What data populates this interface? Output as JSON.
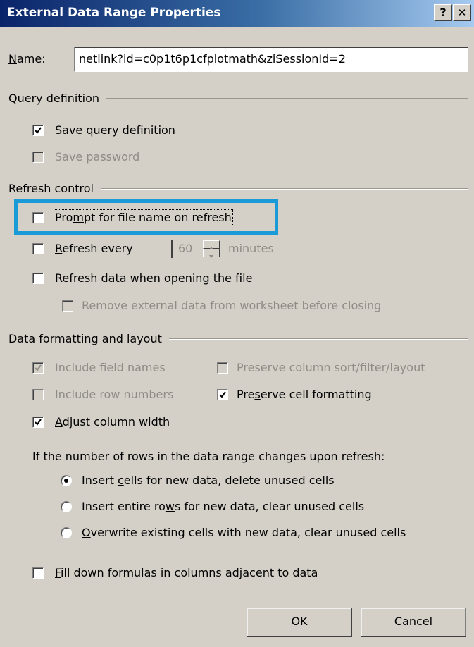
{
  "window": {
    "title": "External Data Range Properties",
    "help_label": "?",
    "close_label": "✕"
  },
  "name_field": {
    "label": "Name:",
    "value": "netlink?id=c0p1t6p1cfplotmath&ziSessionId=2"
  },
  "query_definition": {
    "heading": "Query definition",
    "save_query": {
      "label": "Save query definition",
      "checked": true,
      "enabled": true
    },
    "save_password": {
      "label": "Save password",
      "checked": false,
      "enabled": false
    }
  },
  "refresh_control": {
    "heading": "Refresh control",
    "prompt_file": {
      "label": "Prompt for file name on refresh",
      "checked": false,
      "enabled": true,
      "highlighted": true
    },
    "refresh_every": {
      "label": "Refresh every",
      "checked": false,
      "value": "60",
      "unit": "minutes"
    },
    "refresh_on_open": {
      "label": "Refresh data when opening the file",
      "checked": false
    },
    "remove_external": {
      "label": "Remove external data from worksheet before closing",
      "checked": false,
      "enabled": false
    }
  },
  "data_formatting": {
    "heading": "Data formatting and layout",
    "include_field_names": {
      "label": "Include field names",
      "checked": true,
      "enabled": false
    },
    "preserve_sort": {
      "label": "Preserve column sort/filter/layout",
      "checked": false,
      "enabled": false
    },
    "include_row_numbers": {
      "label": "Include row numbers",
      "checked": false,
      "enabled": false
    },
    "preserve_cell_formatting": {
      "label": "Preserve cell formatting",
      "checked": true,
      "enabled": true
    },
    "adjust_column_width": {
      "label": "Adjust column width",
      "checked": true,
      "enabled": true
    },
    "rows_change_prompt": "If the number of rows in the data range changes upon refresh:",
    "options": [
      {
        "label": "Insert cells for new data, delete unused cells",
        "selected": true
      },
      {
        "label": "Insert entire rows for new data, clear unused cells",
        "selected": false
      },
      {
        "label": "Overwrite existing cells with new data, clear unused cells",
        "selected": false
      }
    ],
    "fill_down": {
      "label": "Fill down formulas in columns adjacent to data",
      "checked": false
    }
  },
  "buttons": {
    "ok": "OK",
    "cancel": "Cancel"
  },
  "colors": {
    "dialog_face": "#d4d0c8",
    "title_gradient_start": "#0a246a",
    "title_gradient_end": "#a6caf0",
    "highlight_border": "#1a9ad6"
  }
}
